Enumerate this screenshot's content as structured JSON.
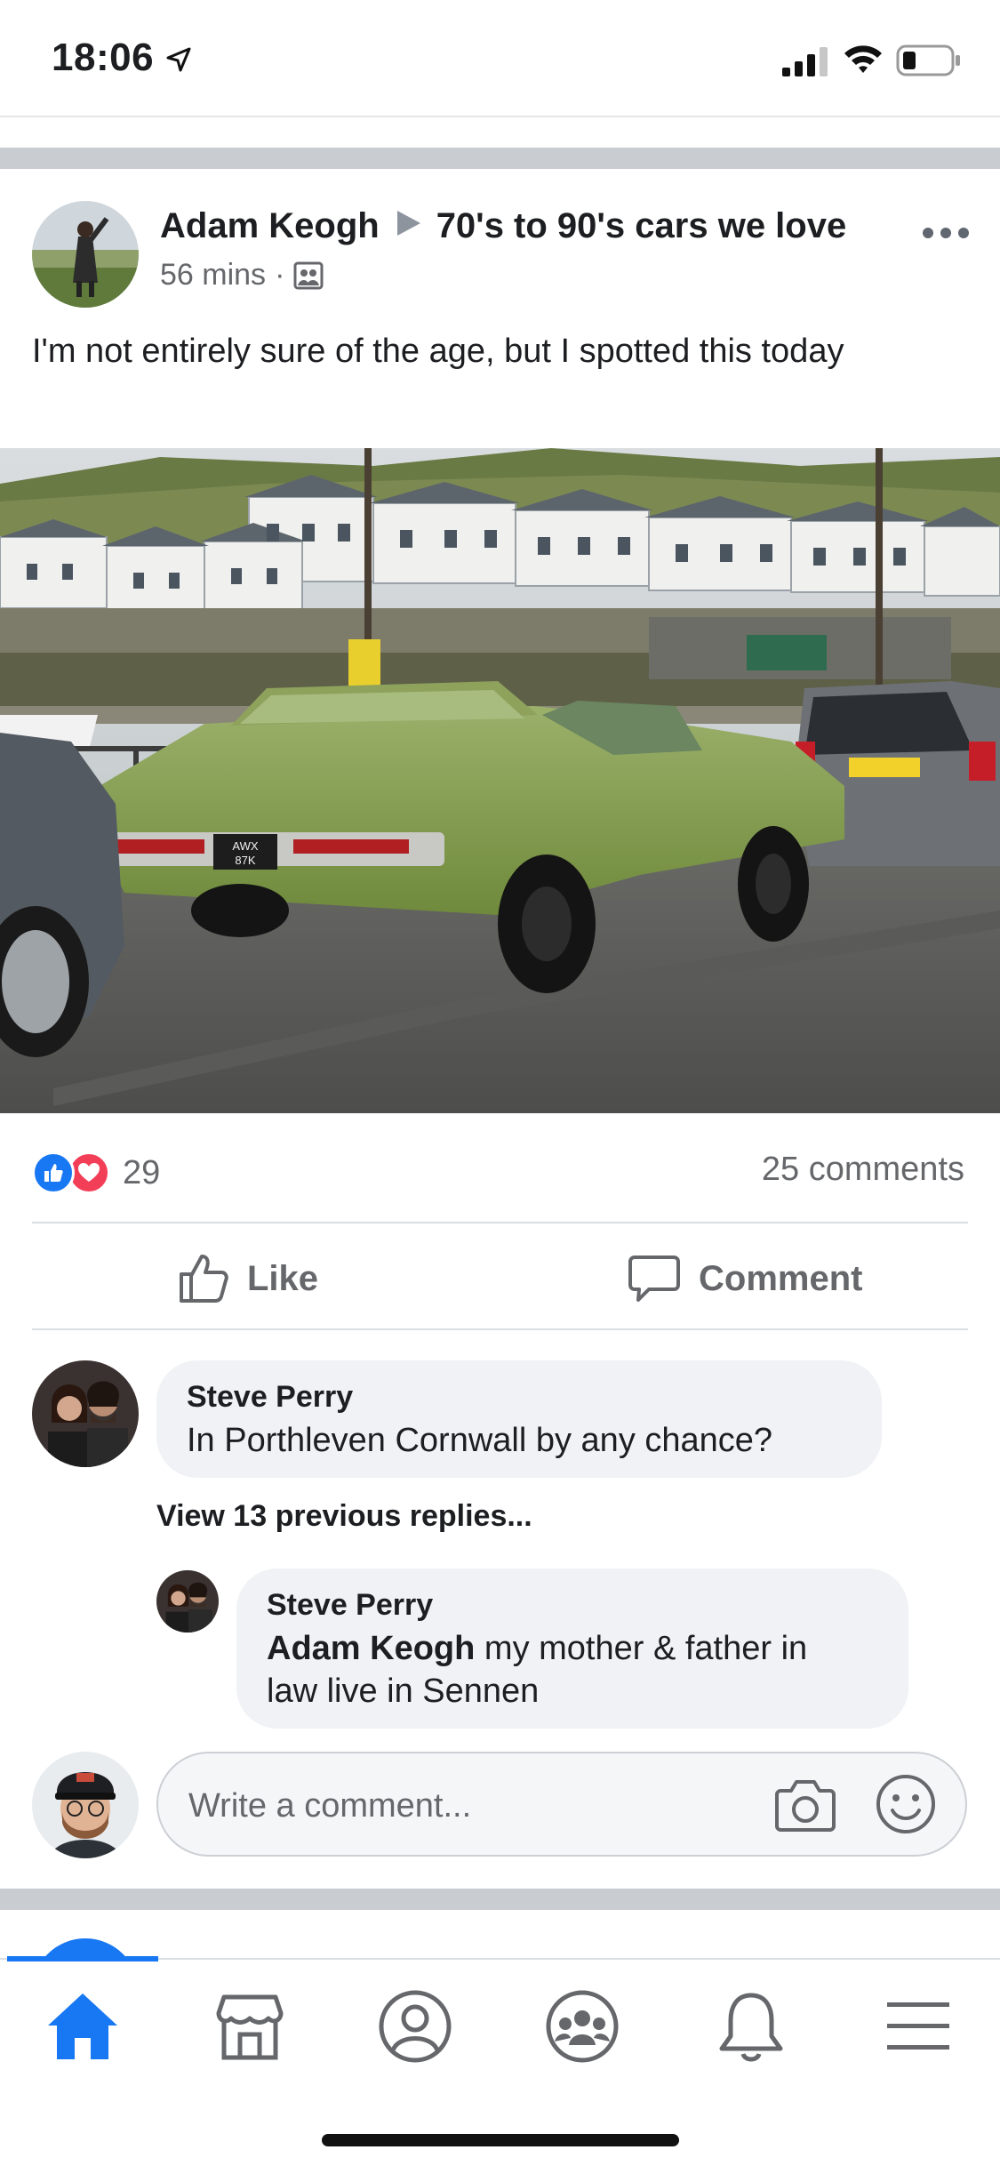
{
  "status_bar": {
    "time": "18:06"
  },
  "post": {
    "author": "Adam Keogh",
    "group": "70's to 90's cars we love",
    "time_ago": "56 mins",
    "separator": "·",
    "text": "I'm not entirely sure of the age, but I spotted this today",
    "reaction_count": "29",
    "comment_count": "25 comments",
    "actions": {
      "like_label": "Like",
      "comment_label": "Comment"
    }
  },
  "comments": {
    "first": {
      "name": "Steve Perry",
      "text": "In Porthleven Cornwall by any chance?"
    },
    "view_replies_label": "View 13 previous replies...",
    "reply": {
      "name": "Steve Perry",
      "mention": "Adam Keogh",
      "text_line1": " my mother & father in",
      "text_line2": "law live in Sennen"
    },
    "write_placeholder": "Write a comment..."
  },
  "colors": {
    "accent": "#1877f2",
    "love": "#f33e58",
    "muted_text": "#65676b"
  },
  "icons": {
    "reactions": [
      "like-reaction-icon",
      "love-reaction-icon"
    ],
    "tabs": [
      "home-icon",
      "marketplace-icon",
      "profile-icon",
      "groups-icon",
      "notifications-icon",
      "menu-icon"
    ]
  },
  "tabbar": {
    "active_tab": "home"
  }
}
